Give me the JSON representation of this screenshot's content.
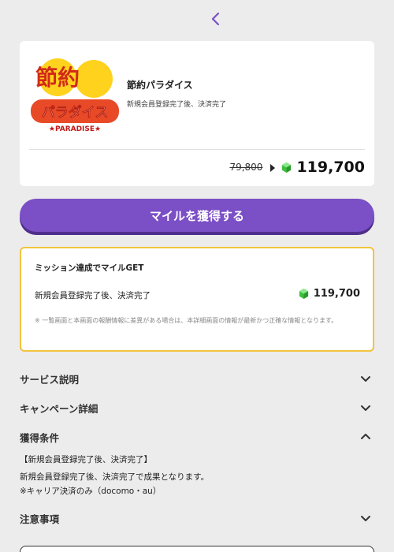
{
  "nav": {
    "back_icon": "chevron-left-icon"
  },
  "offer": {
    "logo_line1": "節約",
    "logo_line2": "パラダイス",
    "logo_line3": "★PARADISE★",
    "title": "節約パラダイス",
    "condition": "新規会員登録完了後、決済完了",
    "old_price": "79,800",
    "new_price": "119,700"
  },
  "cta": {
    "label": "マイルを獲得する"
  },
  "mission": {
    "title": "ミッション達成でマイルGET",
    "row_label": "新規会員登録完了後、決済完了",
    "reward": "119,700",
    "note": "※ 一覧画面と本画面の報酬情報に差異がある場合は、本詳細画面の情報が最新かつ正確な情報となります。"
  },
  "sections": {
    "service": "サービス説明",
    "campaign": "キャンペーン詳細",
    "conditions": "獲得条件",
    "notes": "注意事項"
  },
  "conditions_body": {
    "heading": "【新規会員登録完了後、決済完了】",
    "line1": "新規会員登録完了後、決済完了で成果となります。",
    "line2": "※キャリア決済のみ（docomo・au）"
  },
  "colors": {
    "accent": "#7b4fc5",
    "mission_border": "#f2c33c",
    "gem": "#3fbf3f"
  }
}
